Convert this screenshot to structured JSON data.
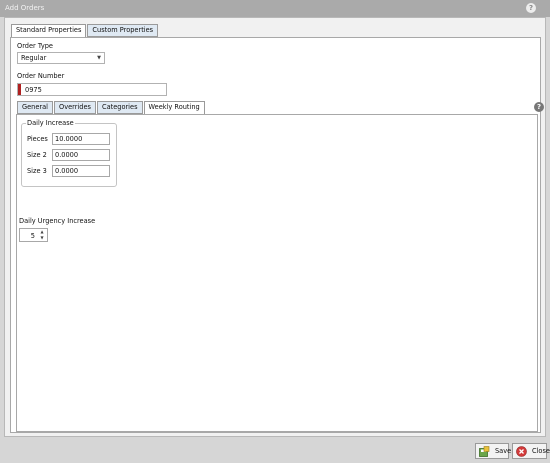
{
  "window": {
    "title": "Add Orders",
    "help_glyph": "?"
  },
  "outer_tabs": [
    "Standard Properties",
    "Custom Properties"
  ],
  "form": {
    "order_type_label": "Order Type",
    "order_type_value": "Regular",
    "order_number_label": "Order Number",
    "order_number_value": "0975"
  },
  "inner_tabs": [
    "General",
    "Overrides",
    "Categories",
    "Weekly Routing"
  ],
  "daily_increase": {
    "title": "Daily Increase",
    "rows": [
      {
        "label": "Pieces",
        "value": "10.0000"
      },
      {
        "label": "Size 2",
        "value": "0.0000"
      },
      {
        "label": "Size 3",
        "value": "0.0000"
      }
    ]
  },
  "daily_urgency": {
    "label": "Daily Urgency Increase",
    "value": "5"
  },
  "buttons": {
    "save": "Save",
    "close": "Close"
  },
  "colors": {
    "required_marker": "#b02020",
    "active_tab": "#ffffff",
    "inactive_tab": "#dfe9f3",
    "title_bar": "#aaaaaa"
  },
  "icons": {
    "help": "help-icon",
    "dropdown": "chevron-down-icon",
    "save": "save-icon",
    "close": "close-icon"
  }
}
